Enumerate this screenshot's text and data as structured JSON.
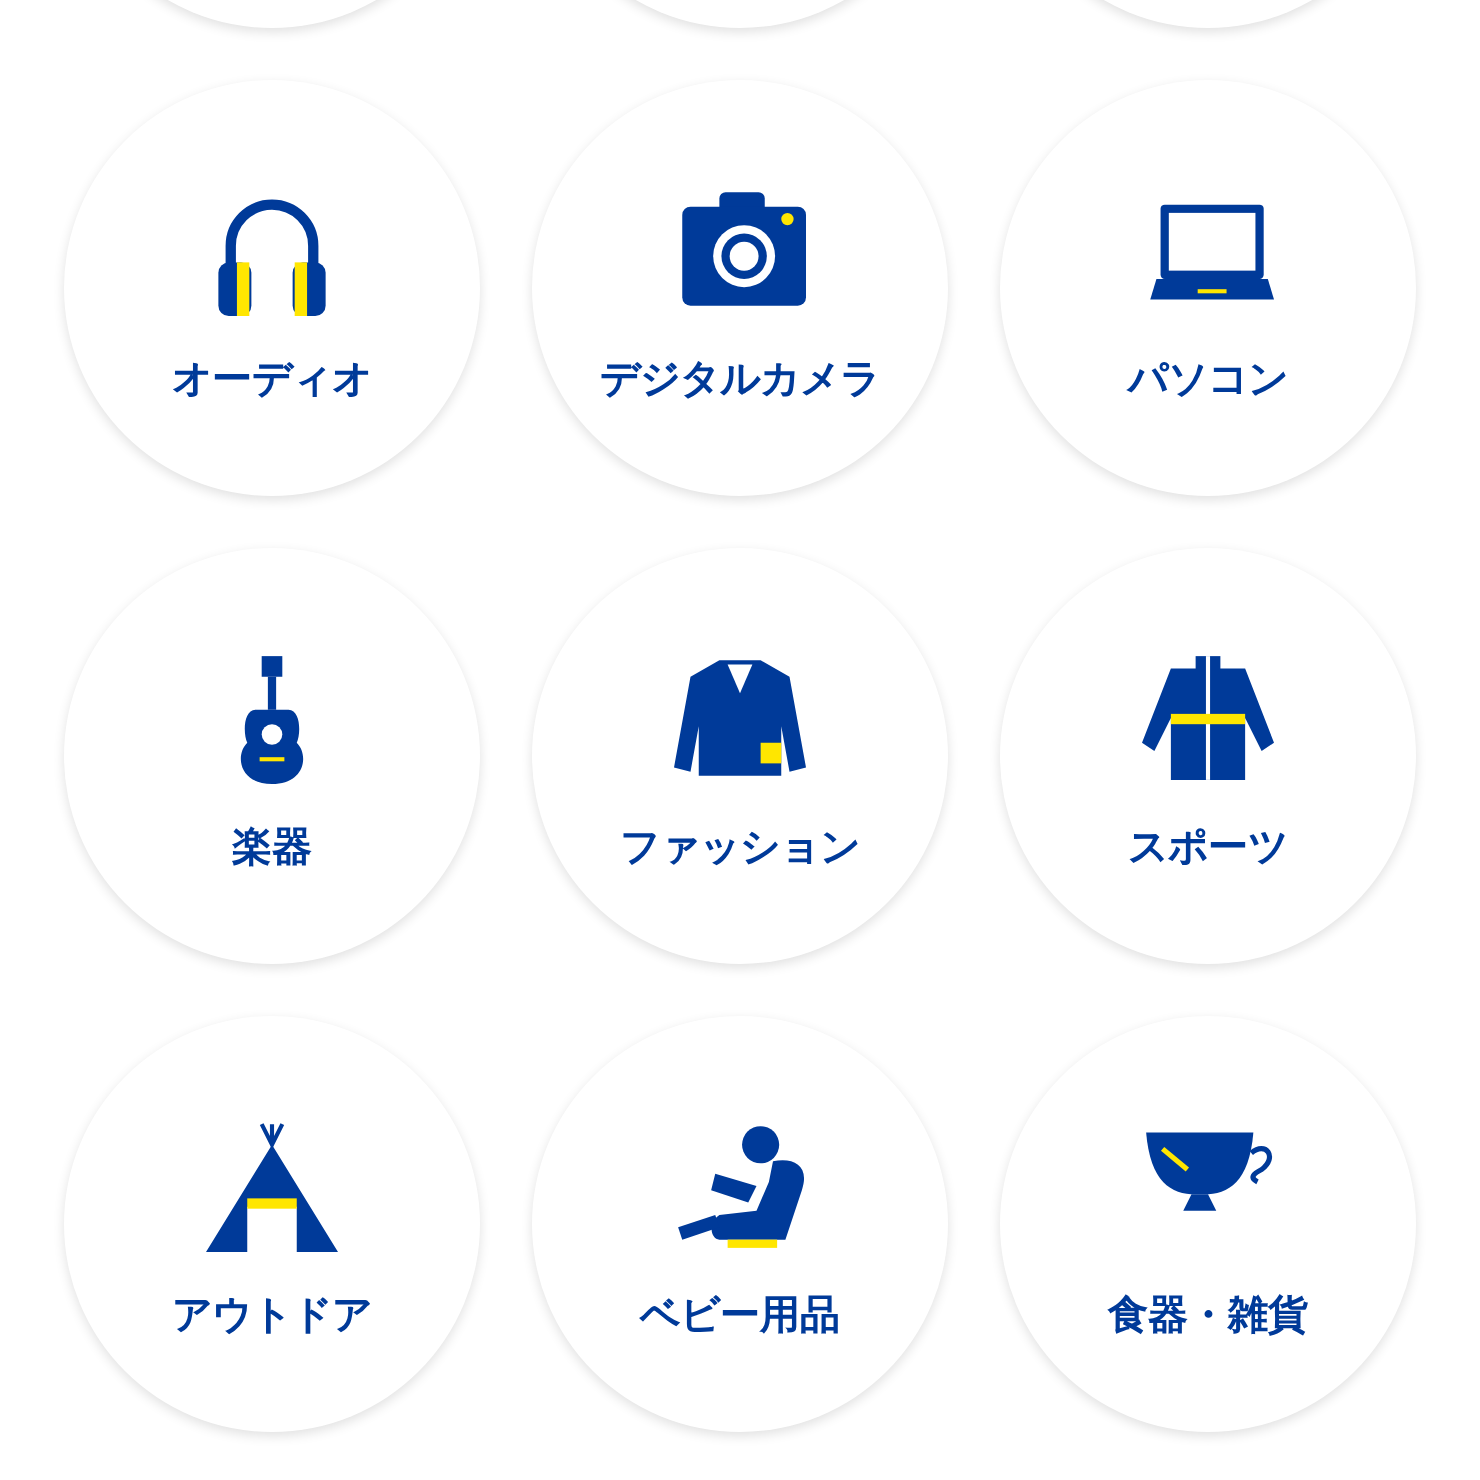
{
  "categories": [
    {
      "label": "オーディオ",
      "kind": "headphones"
    },
    {
      "label": "デジタルカメラ",
      "kind": "camera"
    },
    {
      "label": "パソコン",
      "kind": "laptop"
    },
    {
      "label": "楽器",
      "kind": "guitar"
    },
    {
      "label": "ファッション",
      "kind": "jacket"
    },
    {
      "label": "スポーツ",
      "kind": "coat"
    },
    {
      "label": "アウトドア",
      "kind": "tent"
    },
    {
      "label": "ベビー用品",
      "kind": "carseat"
    },
    {
      "label": "食器・雑貨",
      "kind": "cup"
    }
  ]
}
